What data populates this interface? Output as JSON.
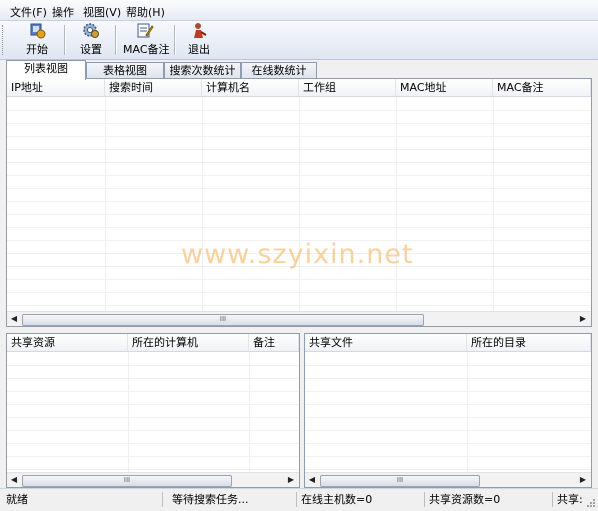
{
  "menu": {
    "file": "文件(F)",
    "operate": "操作",
    "view": "视图(V)",
    "help": "帮助(H)"
  },
  "toolbar": {
    "start": "开始",
    "settings": "设置",
    "mac_note": "MAC备注",
    "exit": "退出"
  },
  "tabs": [
    "列表视图",
    "表格视图",
    "搜索次数统计",
    "在线数统计"
  ],
  "main_table": {
    "columns": [
      "IP地址",
      "搜索时间",
      "计算机名",
      "工作组",
      "MAC地址",
      "MAC备注"
    ]
  },
  "share_table": {
    "columns": [
      "共享资源",
      "所在的计算机",
      "备注"
    ]
  },
  "file_table": {
    "columns": [
      "共享文件",
      "所在的目录"
    ]
  },
  "watermark": "www.szyixin.net",
  "statusbar": {
    "ready": "就绪",
    "waiting": "等待搜索任务...",
    "online": "在线主机数=0",
    "shares": "共享资源数=0",
    "share_cut": "共享:"
  },
  "scroll_thumb": "III"
}
